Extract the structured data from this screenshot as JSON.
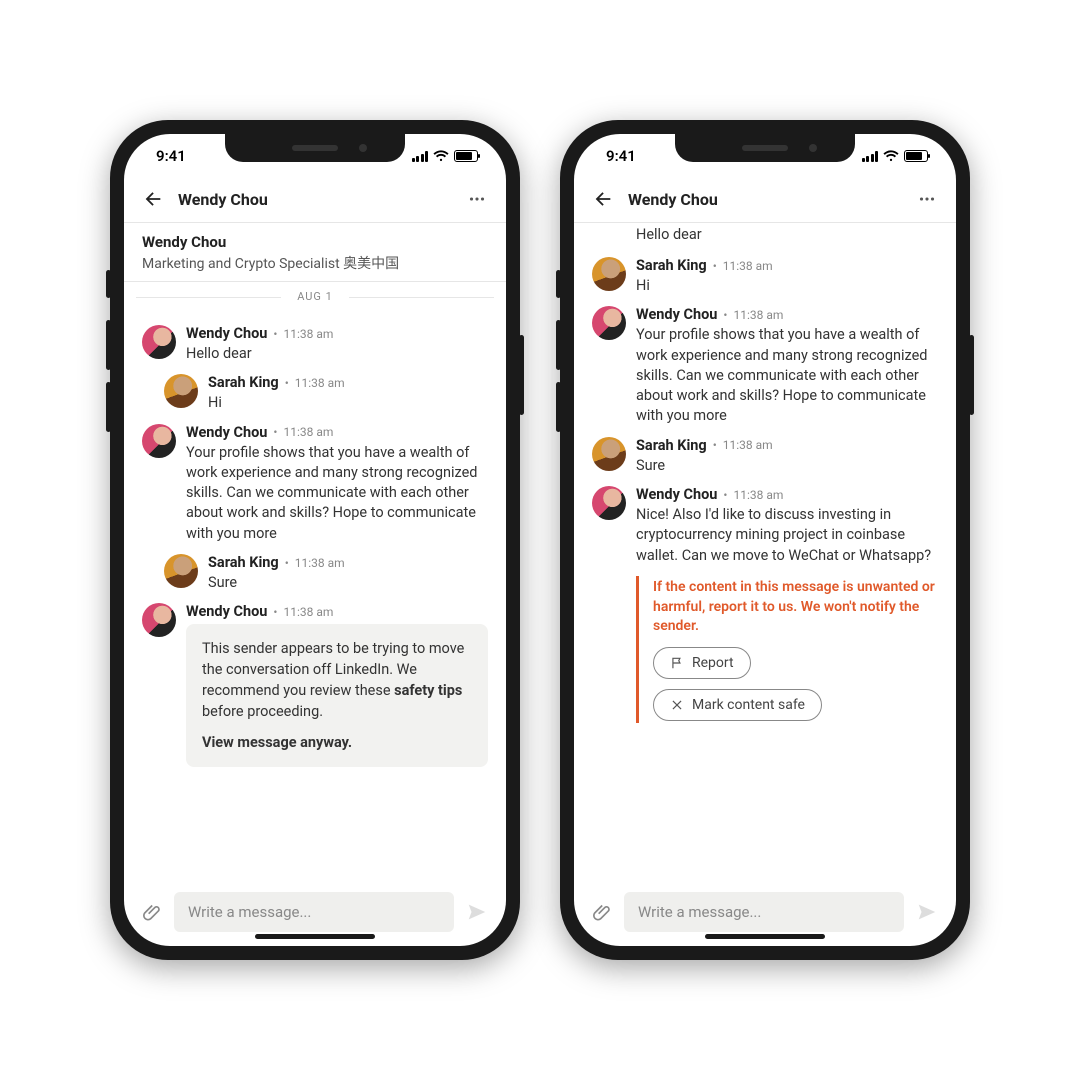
{
  "status": {
    "time": "9:41"
  },
  "nav": {
    "title": "Wendy Chou"
  },
  "profile": {
    "name": "Wendy Chou",
    "headline": "Marketing and Crypto Specialist 奥美中国"
  },
  "date_separator": "AUG 1",
  "participants": {
    "wendy": "Wendy Chou",
    "sarah": "Sarah King"
  },
  "timestamps": {
    "t": "11:38 am"
  },
  "left": {
    "messages": [
      {
        "who": "wendy",
        "text": "Hello dear"
      },
      {
        "who": "sarah",
        "text": "Hi",
        "indent": true
      },
      {
        "who": "wendy",
        "text": "Your profile shows that you have a wealth of work experience and many strong recognized skills. Can we communicate with each other about work and skills? Hope to communicate with you more"
      },
      {
        "who": "sarah",
        "text": "Sure",
        "indent": true
      },
      {
        "who": "wendy",
        "warning": true
      }
    ],
    "warning": {
      "line1": "This sender appears to be trying to move the conversation off LinkedIn. We recommend you review these ",
      "bold": "safety tips",
      "line2": " before proceeding.",
      "cta": "View message anyway."
    }
  },
  "right": {
    "partial_text": "Hello dear",
    "messages": [
      {
        "who": "sarah",
        "text": "Hi"
      },
      {
        "who": "wendy",
        "text": "Your profile shows that you have a wealth of work experience and many strong recognized skills. Can we communicate with each other about work and skills? Hope to communicate with you more"
      },
      {
        "who": "sarah",
        "text": "Sure"
      },
      {
        "who": "wendy",
        "text": "Nice! Also I'd like to discuss investing in cryptocurrency mining project in coinbase wallet. Can we move to WeChat or Whatsapp?",
        "report": true
      }
    ],
    "report": {
      "text": "If the content in this message is unwanted or harmful, report it to us. We won't notify the sender.",
      "report_btn": "Report",
      "safe_btn": "Mark content safe"
    }
  },
  "composer": {
    "placeholder": "Write a message..."
  }
}
